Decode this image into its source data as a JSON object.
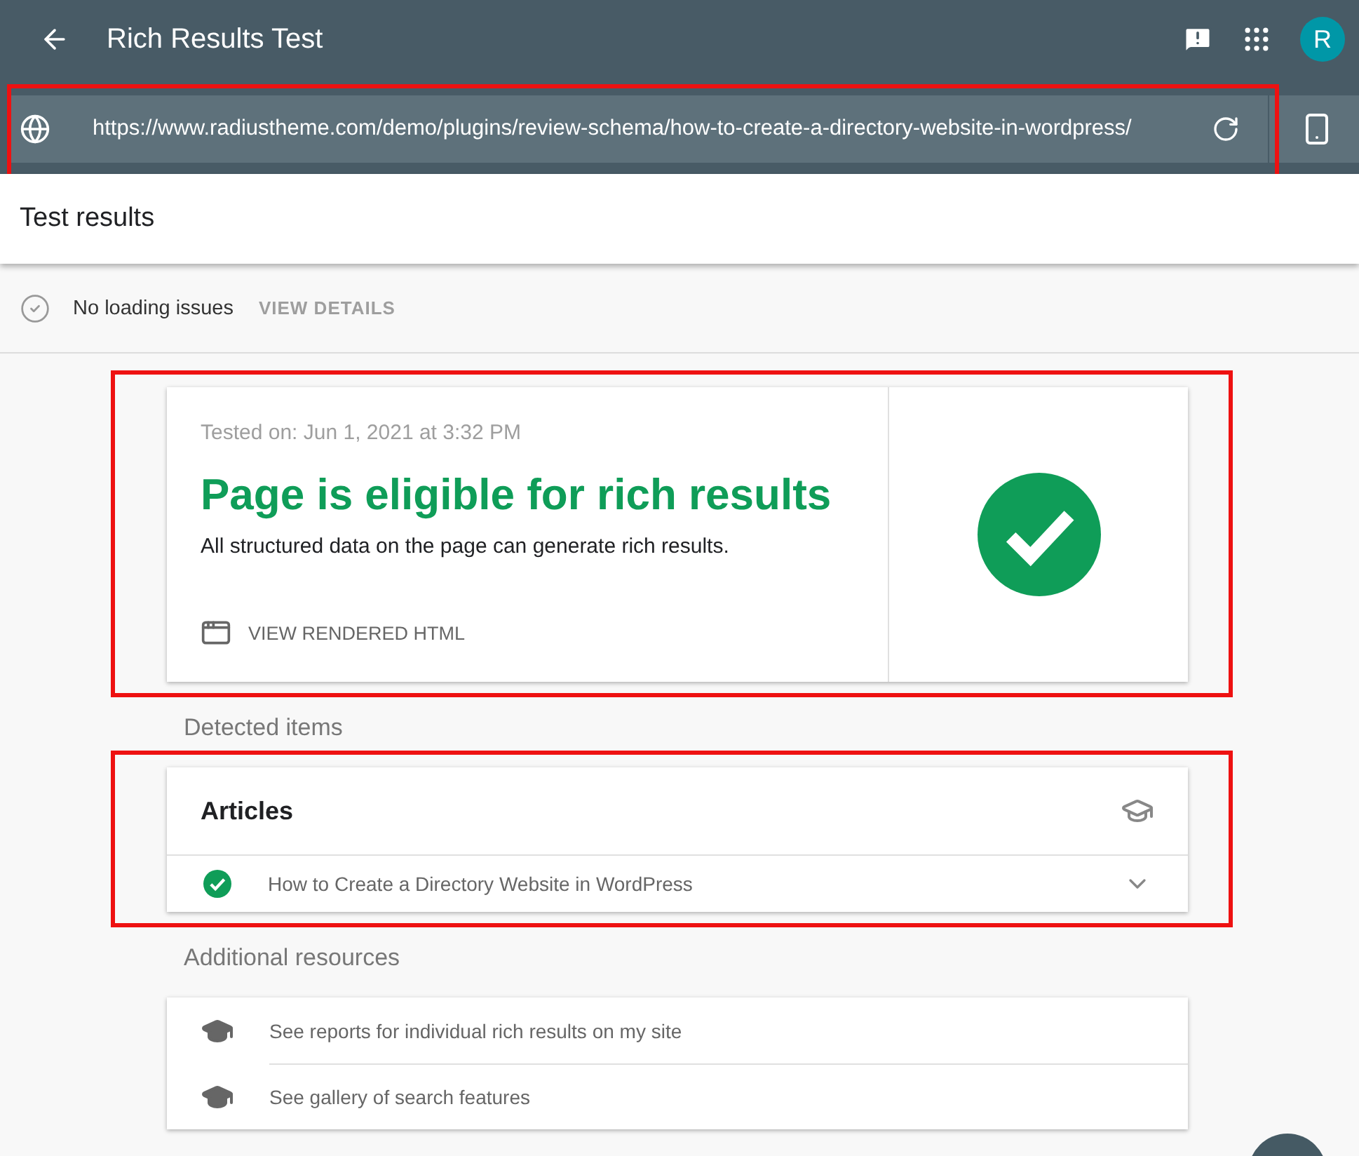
{
  "app": {
    "title": "Rich Results Test",
    "avatar": "R"
  },
  "url_bar": {
    "url": "https://www.radiustheme.com/demo/plugins/review-schema/how-to-create-a-directory-website-in-wordpress/",
    "highlighted": true
  },
  "section_title": "Test results",
  "loading": {
    "text": "No loading issues",
    "action": "VIEW DETAILS"
  },
  "summary": {
    "tested_on": "Tested on: Jun 1, 2021 at 3:32 PM",
    "headline": "Page is eligible for rich results",
    "description": "All structured data on the page can generate rich results.",
    "action": "VIEW RENDERED HTML",
    "valid": true,
    "highlighted": true
  },
  "detected": {
    "heading": "Detected items",
    "highlighted": true,
    "groups": [
      {
        "title": "Articles",
        "items": [
          {
            "title": "How to Create a Directory Website in WordPress",
            "valid": true,
            "expanded": false
          }
        ]
      }
    ]
  },
  "resources": {
    "heading": "Additional resources",
    "items": [
      "See reports for individual rich results on my site",
      "See gallery of search features"
    ]
  }
}
